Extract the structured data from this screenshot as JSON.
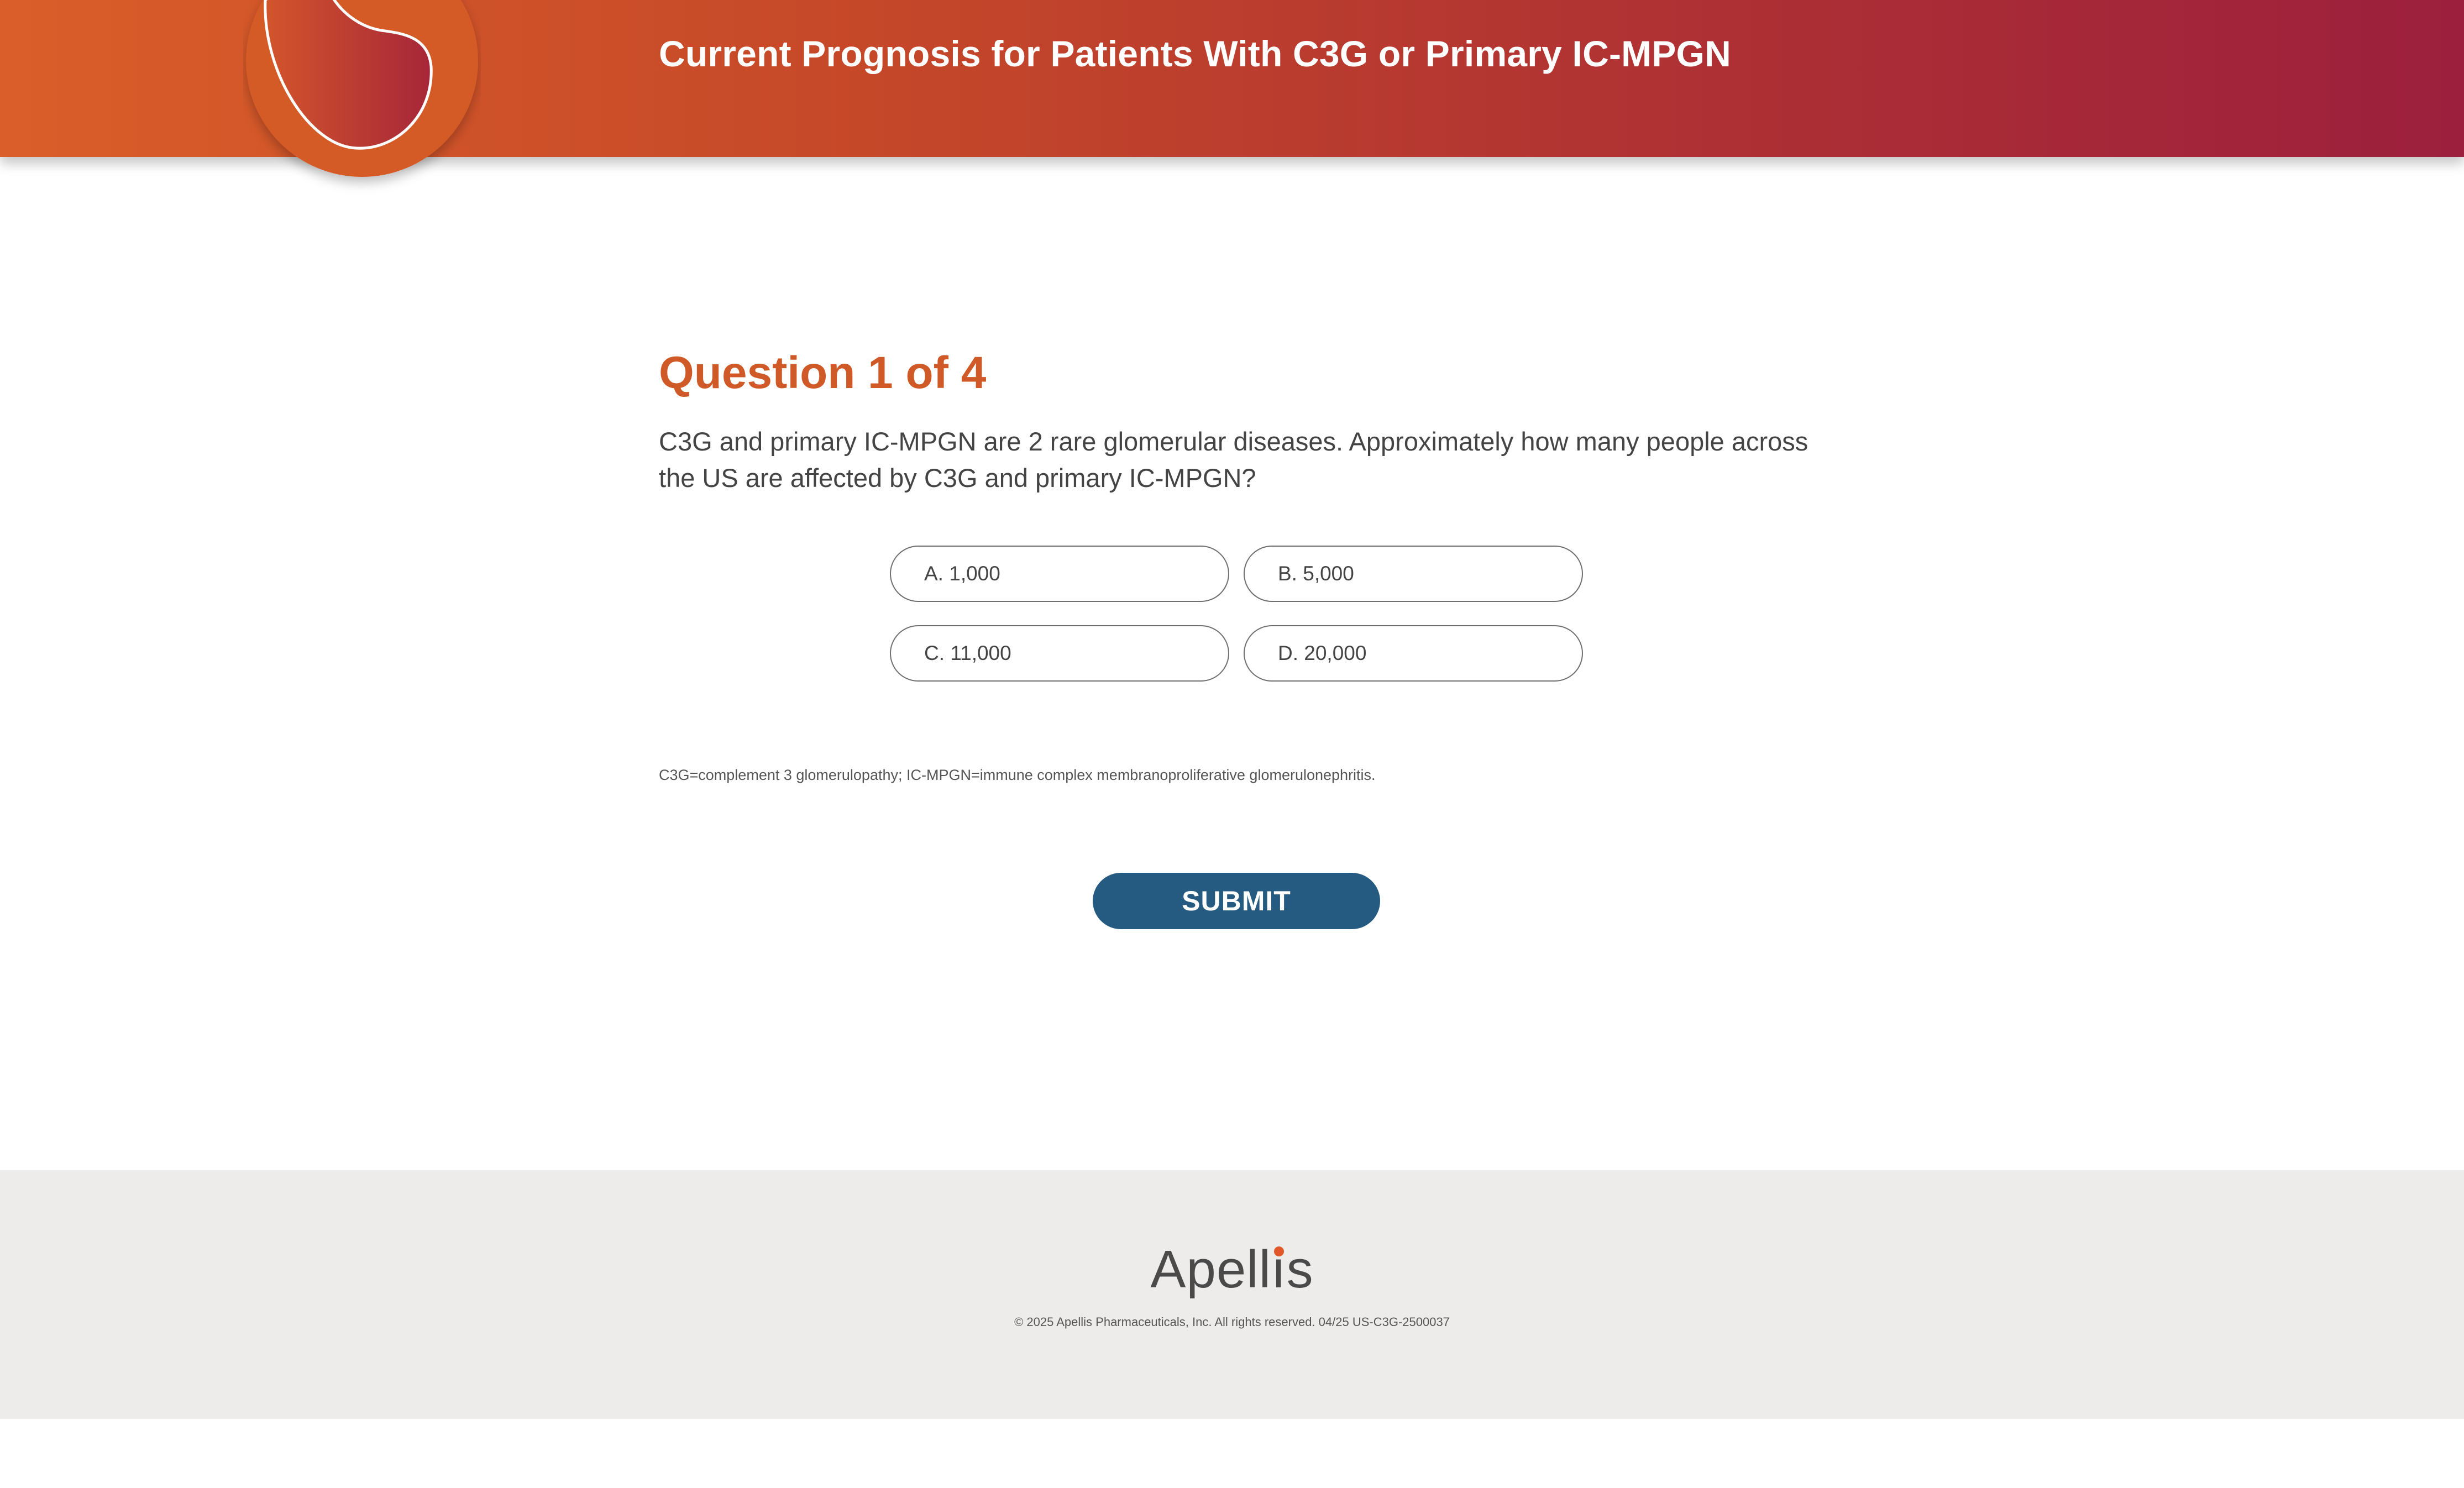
{
  "header": {
    "title": "Current Prognosis for Patients With C3G or Primary IC-MPGN",
    "badge_icon": "kidney-icon"
  },
  "question": {
    "heading": "Question 1 of 4",
    "text": "C3G and primary IC-MPGN are 2 rare glomerular diseases. Approximately how many people across the US are affected by C3G and primary IC-MPGN?",
    "answers": [
      {
        "label": "A. 1,000"
      },
      {
        "label": "B. 5,000"
      },
      {
        "label": "C. 11,000"
      },
      {
        "label": "D. 20,000"
      }
    ],
    "footnote": "C3G=complement 3 glomerulopathy; IC-MPGN=immune complex membranoproliferative glomerulonephritis.",
    "submit_label": "SUBMIT"
  },
  "footer": {
    "logo_text": "Apellis",
    "copyright": "© 2025 Apellis Pharmaceuticals, Inc. All rights reserved. 04/25 US-C3G-2500037"
  },
  "colors": {
    "header_gradient_start": "#da5e29",
    "header_gradient_end": "#9c1f3d",
    "heading_orange": "#d05a27",
    "submit_blue": "#255b80",
    "footer_bg": "#edecea",
    "logo_dot": "#e0572a"
  }
}
